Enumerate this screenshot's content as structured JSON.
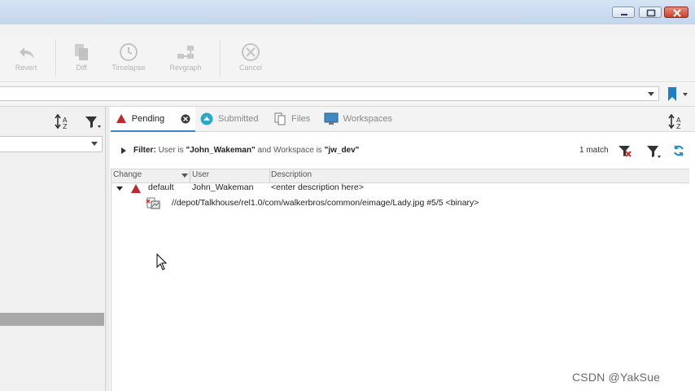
{
  "toolbar": {
    "revert_label": "Revert",
    "diff_label": "Diff",
    "timelapse_label": "Timelapse",
    "revgraph_label": "Revgraph",
    "cancel_label": "Cancel"
  },
  "tabs": [
    {
      "label": "Pending",
      "icon": "pending-icon",
      "active": true
    },
    {
      "label": "Submitted",
      "icon": "submitted-icon",
      "active": false
    },
    {
      "label": "Files",
      "icon": "files-icon",
      "active": false
    },
    {
      "label": "Workspaces",
      "icon": "workspaces-icon",
      "active": false
    }
  ],
  "filter": {
    "label": "Filter:",
    "prefix": "User is ",
    "user": "\"John_Wakeman\"",
    "middle": " and Workspace is ",
    "workspace": "\"jw_dev\"",
    "match_count": "1 match"
  },
  "grid": {
    "columns": [
      "Change",
      "User",
      "Description"
    ],
    "changelist": {
      "change": "default",
      "user": "John_Wakeman",
      "description": "<enter description here>"
    },
    "file_path": "//depot/Talkhouse/rel1.0/com/walkerbros/common/eimage/Lady.jpg #5/5 <binary>"
  },
  "watermark": "CSDN @YakSue",
  "colors": {
    "accent": "#3a86c8",
    "pending_red": "#c0282d",
    "submitted_teal": "#2aa8c9",
    "refresh_blue": "#1e8fd0"
  }
}
